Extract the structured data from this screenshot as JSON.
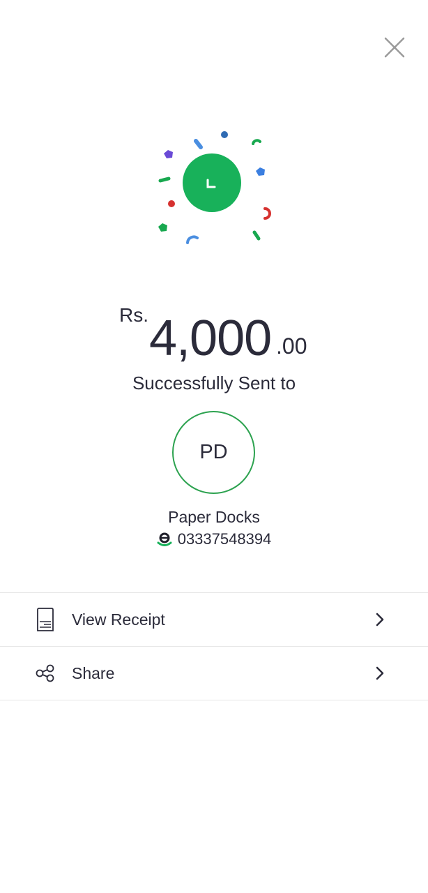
{
  "header": {
    "close_icon": "close-icon"
  },
  "celebration": {
    "icon": "checkmark-icon",
    "accent_color": "#18b15a"
  },
  "transaction": {
    "currency": "Rs.",
    "amount_main": "4,000",
    "amount_decimal": ".00",
    "status_text": "Successfully Sent to"
  },
  "recipient": {
    "initials": "PD",
    "name": "Paper Docks",
    "wallet_icon": "easypaisa-icon",
    "phone": "03337548394"
  },
  "actions": [
    {
      "label": "View Receipt",
      "icon": "receipt-icon"
    },
    {
      "label": "Share",
      "icon": "share-icon"
    }
  ],
  "colors": {
    "success_green": "#18b15a",
    "avatar_border": "#2ca24f",
    "text": "#2b2b3a",
    "divider": "#e6e6e6"
  }
}
